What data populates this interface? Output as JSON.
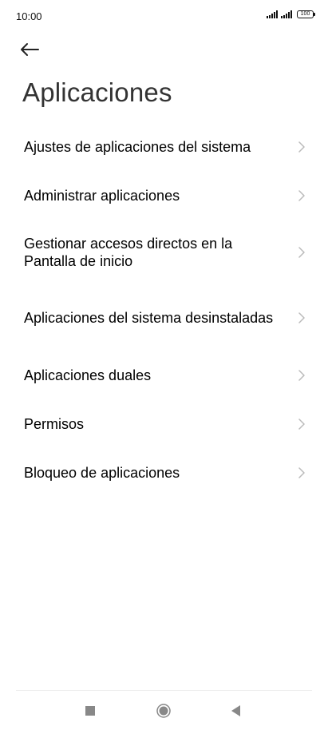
{
  "status_bar": {
    "time": "10:00",
    "battery_level": "100",
    "icons": [
      "signal-icon",
      "signal-icon",
      "battery-icon"
    ]
  },
  "header": {
    "back_icon": "arrow-left-icon",
    "title": "Aplicaciones"
  },
  "menu": {
    "items": [
      {
        "label": "Ajustes de aplicaciones del sistema"
      },
      {
        "label": "Administrar aplicaciones"
      },
      {
        "label": "Gestionar accesos directos en la Pantalla de inicio"
      },
      {
        "label": "Aplicaciones del sistema desinstaladas"
      },
      {
        "label": "Aplicaciones duales"
      },
      {
        "label": "Permisos"
      },
      {
        "label": "Bloqueo de aplicaciones"
      }
    ],
    "chevron_icon": "chevron-right-icon"
  },
  "nav_bar": {
    "icons": [
      "recents-square-icon",
      "home-circle-icon",
      "back-triangle-icon"
    ]
  },
  "colors": {
    "background": "#ffffff",
    "title": "#333333",
    "label": "#000000",
    "chevron": "#bbbbbb",
    "nav_icon": "#888888"
  }
}
